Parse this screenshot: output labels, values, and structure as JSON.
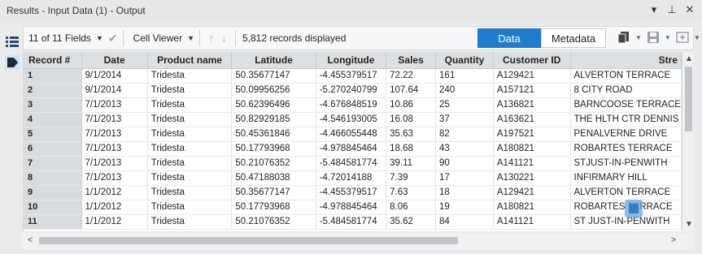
{
  "window": {
    "title": "Results - Input Data (1) - Output",
    "controls": [
      "▾",
      "⊥",
      "✕"
    ]
  },
  "toolbar": {
    "fields_label": "11 of 11 Fields",
    "viewer_label": "Cell Viewer",
    "records_label": "5,812 records displayed",
    "data_label": "Data",
    "metadata_label": "Metadata",
    "active_tab": "Data",
    "accent": "#1f7ccc"
  },
  "table": {
    "columns": [
      "Record #",
      "Date",
      "Product name",
      "Latitude",
      "Longitude",
      "Sales",
      "Quantity",
      "Customer ID",
      "Stre"
    ],
    "rows": [
      [
        "1",
        "9/1/2014",
        "Tridesta",
        "50.35677147",
        "-4.455379517",
        "72.22",
        "161",
        "A129421",
        "ALVERTON TERRACE"
      ],
      [
        "2",
        "9/1/2014",
        "Tridesta",
        "50.09956256",
        "-5.270240799",
        "107.64",
        "240",
        "A157121",
        "8 CITY ROAD"
      ],
      [
        "3",
        "7/1/2013",
        "Tridesta",
        "50.62396496",
        "-4.676848519",
        "10.86",
        "25",
        "A136821",
        "BARNCOOSE TERRACE"
      ],
      [
        "4",
        "7/1/2013",
        "Tridesta",
        "50.82929185",
        "-4.546193005",
        "16.08",
        "37",
        "A163621",
        "THE HLTH CTR  DENNIS"
      ],
      [
        "5",
        "7/1/2013",
        "Tridesta",
        "50.45361846",
        "-4.466055448",
        "35.63",
        "82",
        "A197521",
        "PENALVERNE DRIVE"
      ],
      [
        "6",
        "7/1/2013",
        "Tridesta",
        "50.17793968",
        "-4.978845464",
        "18.68",
        "43",
        "A180821",
        "ROBARTES TERRACE"
      ],
      [
        "7",
        "7/1/2013",
        "Tridesta",
        "50.21076352",
        "-5.484581774",
        "39.11",
        "90",
        "A141121",
        "STJUST-IN-PENWITH"
      ],
      [
        "8",
        "7/1/2013",
        "Tridesta",
        "50.47188038",
        "-4.72014188",
        "7.39",
        "17",
        "A130221",
        "INFIRMARY HILL"
      ],
      [
        "9",
        "1/1/2012",
        "Tridesta",
        "50.35677147",
        "-4.455379517",
        "7.63",
        "18",
        "A129421",
        "ALVERTON TERRACE"
      ],
      [
        "10",
        "1/1/2012",
        "Tridesta",
        "50.17793968",
        "-4.978845464",
        "8.06",
        "19",
        "A180821",
        "ROBARTES TERRACE"
      ],
      [
        "11",
        "1/1/2012",
        "Tridesta",
        "50.21076352",
        "-5.484581774",
        "35.62",
        "84",
        "A141121",
        "ST JUST-IN-PENWITH"
      ]
    ]
  },
  "icons": {
    "left": [
      "list-icon",
      "tag-icon"
    ],
    "toolbar": [
      "check-icon",
      "up-arrow-icon",
      "down-arrow-icon",
      "copy-icon",
      "save-icon",
      "add-column-icon"
    ]
  }
}
